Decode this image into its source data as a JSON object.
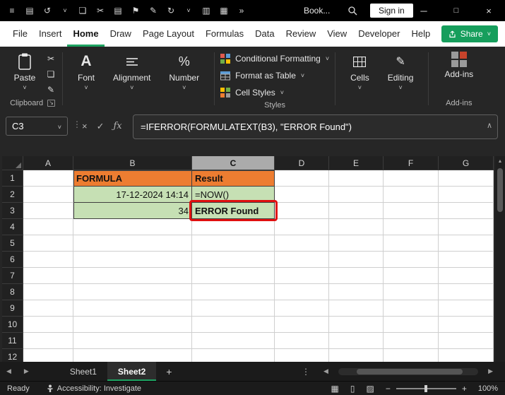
{
  "colors": {
    "accent_green": "#1EA362",
    "share_button_green": "#169E5C",
    "header_fill_orange": "#ED7D31",
    "data_fill_green": "#C6E0B4",
    "annotation_red": "#E01010",
    "titlebar_bg": "#000000",
    "ribbon_bg": "#262626"
  },
  "glyphs": {
    "caret_down": "˅",
    "chevron_up": "∧",
    "close": "×",
    "check": "✓",
    "fx": "ƒx",
    "dots_vertical": "⋮",
    "launcher": "↘",
    "scroll_up": "▲",
    "percent": "%",
    "font_a": "A",
    "pencil": "✎",
    "view_normal": "▦",
    "view_layout": "▯",
    "view_break": "▨",
    "zoom_minus": "−",
    "zoom_plus": "+"
  },
  "title_bar": {
    "quick_access_icons": [
      {
        "name": "menu-icon",
        "glyph": "≡"
      },
      {
        "name": "save-icon",
        "glyph": "▤"
      },
      {
        "name": "undo-icon",
        "glyph": "↺"
      },
      {
        "name": "undo-dropdown-icon",
        "glyph": "˅"
      },
      {
        "name": "copy-icon",
        "glyph": "❏"
      },
      {
        "name": "cut-icon",
        "glyph": "✂"
      },
      {
        "name": "clipboard-icon",
        "glyph": "▤"
      },
      {
        "name": "flag-icon",
        "glyph": "⚑"
      },
      {
        "name": "format-painter-icon",
        "glyph": "✎"
      },
      {
        "name": "redo-icon",
        "glyph": "↻"
      },
      {
        "name": "redo-dropdown-icon",
        "glyph": "˅"
      },
      {
        "name": "printer-icon",
        "glyph": "▥"
      },
      {
        "name": "table-icon",
        "glyph": "▦"
      },
      {
        "name": "overflow-icon",
        "glyph": "»"
      }
    ],
    "document_title": "Book...",
    "sign_in_label": "Sign in",
    "window_controls": [
      {
        "name": "minimize",
        "glyph": "─"
      },
      {
        "name": "maximize",
        "glyph": "□"
      },
      {
        "name": "close",
        "glyph": "×"
      }
    ]
  },
  "menu_bar": {
    "tabs": [
      {
        "label": "File"
      },
      {
        "label": "Insert"
      },
      {
        "label": "Home",
        "active": true
      },
      {
        "label": "Draw"
      },
      {
        "label": "Page Layout"
      },
      {
        "label": "Formulas"
      },
      {
        "label": "Data"
      },
      {
        "label": "Review"
      },
      {
        "label": "View"
      },
      {
        "label": "Developer"
      },
      {
        "label": "Help"
      }
    ],
    "share_label": "Share"
  },
  "ribbon": {
    "paste_label": "Paste",
    "clipboard_group_label": "Clipboard",
    "small_icons": [
      {
        "name": "cut-icon",
        "glyph": "✂"
      },
      {
        "name": "copy-icon",
        "glyph": "❏"
      },
      {
        "name": "format-painter-icon",
        "glyph": "✎"
      }
    ],
    "font_label": "Font",
    "alignment_label": "Alignment",
    "number_label": "Number",
    "styles_items": [
      {
        "label": "Conditional Formatting"
      },
      {
        "label": "Format as Table"
      },
      {
        "label": "Cell Styles"
      }
    ],
    "styles_group_label": "Styles",
    "cells_label": "Cells",
    "editing_label": "Editing",
    "addins_label": "Add-ins",
    "addins_group_label": "Add-ins"
  },
  "formula_bar": {
    "name_box_value": "C3",
    "formula": "=IFERROR(FORMULATEXT(B3), \"ERROR Found\")"
  },
  "grid": {
    "column_headers": [
      "A",
      "B",
      "C",
      "D",
      "E",
      "F",
      "G"
    ],
    "row_headers": [
      "1",
      "2",
      "3",
      "4",
      "5",
      "6",
      "7",
      "8",
      "9",
      "10",
      "11",
      "12"
    ],
    "selected_column": "C",
    "selected_cell": "C3",
    "cells": {
      "B1": {
        "text": "FORMULA",
        "fill": "orange",
        "bold": true,
        "align": "left",
        "edge": "lt"
      },
      "C1": {
        "text": "Result",
        "fill": "orange",
        "bold": true,
        "align": "left",
        "edge": "t"
      },
      "B2": {
        "text": "17-12-2024 14:14",
        "fill": "green",
        "align": "right",
        "edge": "l"
      },
      "C2": {
        "text": "=NOW()",
        "fill": "green",
        "align": "left",
        "edge": ""
      },
      "B3": {
        "text": "34",
        "fill": "green",
        "align": "right",
        "edge": "l"
      },
      "C3": {
        "text": "ERROR Found",
        "fill": "green",
        "bold": true,
        "align": "left",
        "edge": "",
        "annotated": true
      }
    }
  },
  "sheet_tabs": {
    "nav_prev": "◀",
    "nav_next": "▶",
    "tabs": [
      {
        "label": "Sheet1"
      },
      {
        "label": "Sheet2",
        "active": true
      }
    ],
    "add_sheet_label": "+",
    "more_label": "⋮"
  },
  "status_bar": {
    "status": "Ready",
    "accessibility": "Accessibility: Investigate",
    "zoom": "100%"
  }
}
